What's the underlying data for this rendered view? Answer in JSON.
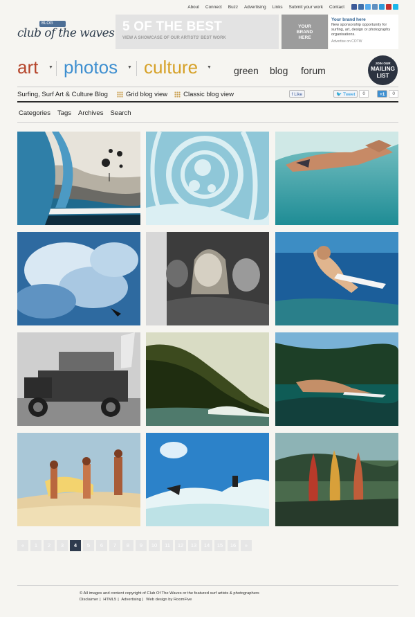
{
  "top_nav": [
    "About",
    "Connect",
    "Buzz",
    "Advertising",
    "Links",
    "Submit your work",
    "Contact"
  ],
  "social_colors": [
    "#3b5998",
    "#3f6faa",
    "#55acee",
    "#5f8fbf",
    "#2d9ad8",
    "#c4302b",
    "#1ab7ea"
  ],
  "logo": {
    "tag": "BLOG",
    "text": "club of the waves"
  },
  "showcase": {
    "title": "5 OF THE BEST",
    "subtitle": "VIEW A SHOWCASE OF OUR ARTISTS' BEST WORK"
  },
  "brand_box": {
    "line1": "YOUR",
    "line2": "BRAND",
    "line3": "HERE"
  },
  "sponsor": {
    "title": "Your brand here",
    "body": "New sponsorship opportunity for surfing, art, design or photography organisations.",
    "link": "Advertise on COTW"
  },
  "main_nav": {
    "art": "art",
    "photos": "photos",
    "culture": "culture",
    "green": "green",
    "blog": "blog",
    "forum": "forum",
    "arrow": "▼",
    "colors": {
      "art": "#b5452b",
      "photos": "#3e8fd0",
      "culture": "#d6a128"
    }
  },
  "mailing": {
    "line1": "JOIN OUR",
    "line2": "MAILING",
    "line3": "LIST"
  },
  "blog_bar": {
    "title": "Surfing, Surf Art & Culture Blog",
    "grid_view": "Grid blog view",
    "classic_view": "Classic blog view",
    "like": "Like",
    "tweet": "Tweet",
    "tweet_count": "0",
    "plus": "+1",
    "plus_count": "0"
  },
  "cat_nav": [
    "Categories",
    "Tags",
    "Archives",
    "Search"
  ],
  "tile_names": [
    "tile-wave-painting",
    "tile-blue-pattern-art",
    "tile-underwater-bikini",
    "tile-breaking-wave",
    "tile-laughing-girls",
    "tile-underwater-surfer",
    "tile-vintage-car",
    "tile-coastal-cliff",
    "tile-palm-paddler",
    "tile-three-surfers-painting",
    "tile-surfer-on-wave",
    "tile-surfboards-painting"
  ],
  "pagination": {
    "prev": "«",
    "next": "»",
    "pages": [
      "1",
      "2",
      "3",
      "4",
      "5",
      "6",
      "7",
      "8",
      "9",
      "10",
      "11",
      "12",
      "13",
      "14",
      "15",
      "16"
    ],
    "current": "4"
  },
  "footer": {
    "copyright": "© All images and content copyright of Club Of The Waves or the featured surf artists & photographers",
    "links": [
      "Disclaimer",
      "HTML5",
      "Advertising",
      "Web design by RoomFive"
    ]
  }
}
